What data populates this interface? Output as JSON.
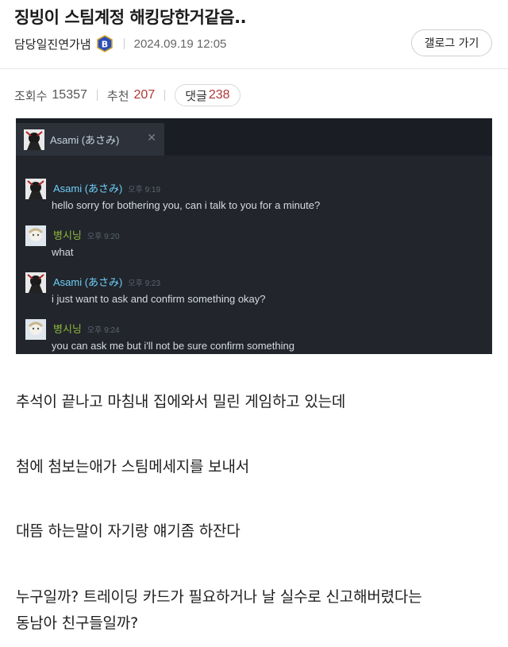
{
  "post": {
    "title": "징빙이 스팀계정 해킹당한거같음..",
    "author": "담당일진연가냄",
    "badge": "B",
    "date": "2024.09.19 12:05",
    "back_button": "갤로그 가기",
    "views_label": "조회수",
    "views": "15357",
    "likes_label": "추천",
    "likes": "207",
    "comments_label": "댓글",
    "comments": "238"
  },
  "steam": {
    "tab_name": "Asami (あさみ)",
    "tab_close": "✕",
    "messages": [
      {
        "name": "Asami (あさみ)",
        "time": "오후 9:19",
        "text": "hello sorry for bothering you, can i talk to you for a minute?"
      },
      {
        "name": "병시닝",
        "time": "오후 9:20",
        "text": "what"
      },
      {
        "name": "Asami (あさみ)",
        "time": "오후 9:23",
        "text": "i just want to ask and confirm something okay?"
      },
      {
        "name": "병시닝",
        "time": "오후 9:24",
        "text": "you can ask me but i'll not be sure confirm something"
      }
    ]
  },
  "body": {
    "p1": "추석이 끝나고 마침내 집에와서 밀린 게임하고 있는데",
    "p2": "첨에 첨보는애가 스팀메세지를 보내서",
    "p3": "대뜸 하는말이 자기랑 얘기좀 하잔다",
    "p4_line1": "누구일까? 트레이딩 카드가 필요하거나 날 실수로 신고해버렸다는",
    "p4_line2": "동남아 친구들일까?"
  },
  "colors": {
    "accent_red": "#b03636",
    "steam_bg": "#22252c",
    "steam_name_blue": "#6dcff6",
    "steam_name_green": "#8fb93b"
  }
}
